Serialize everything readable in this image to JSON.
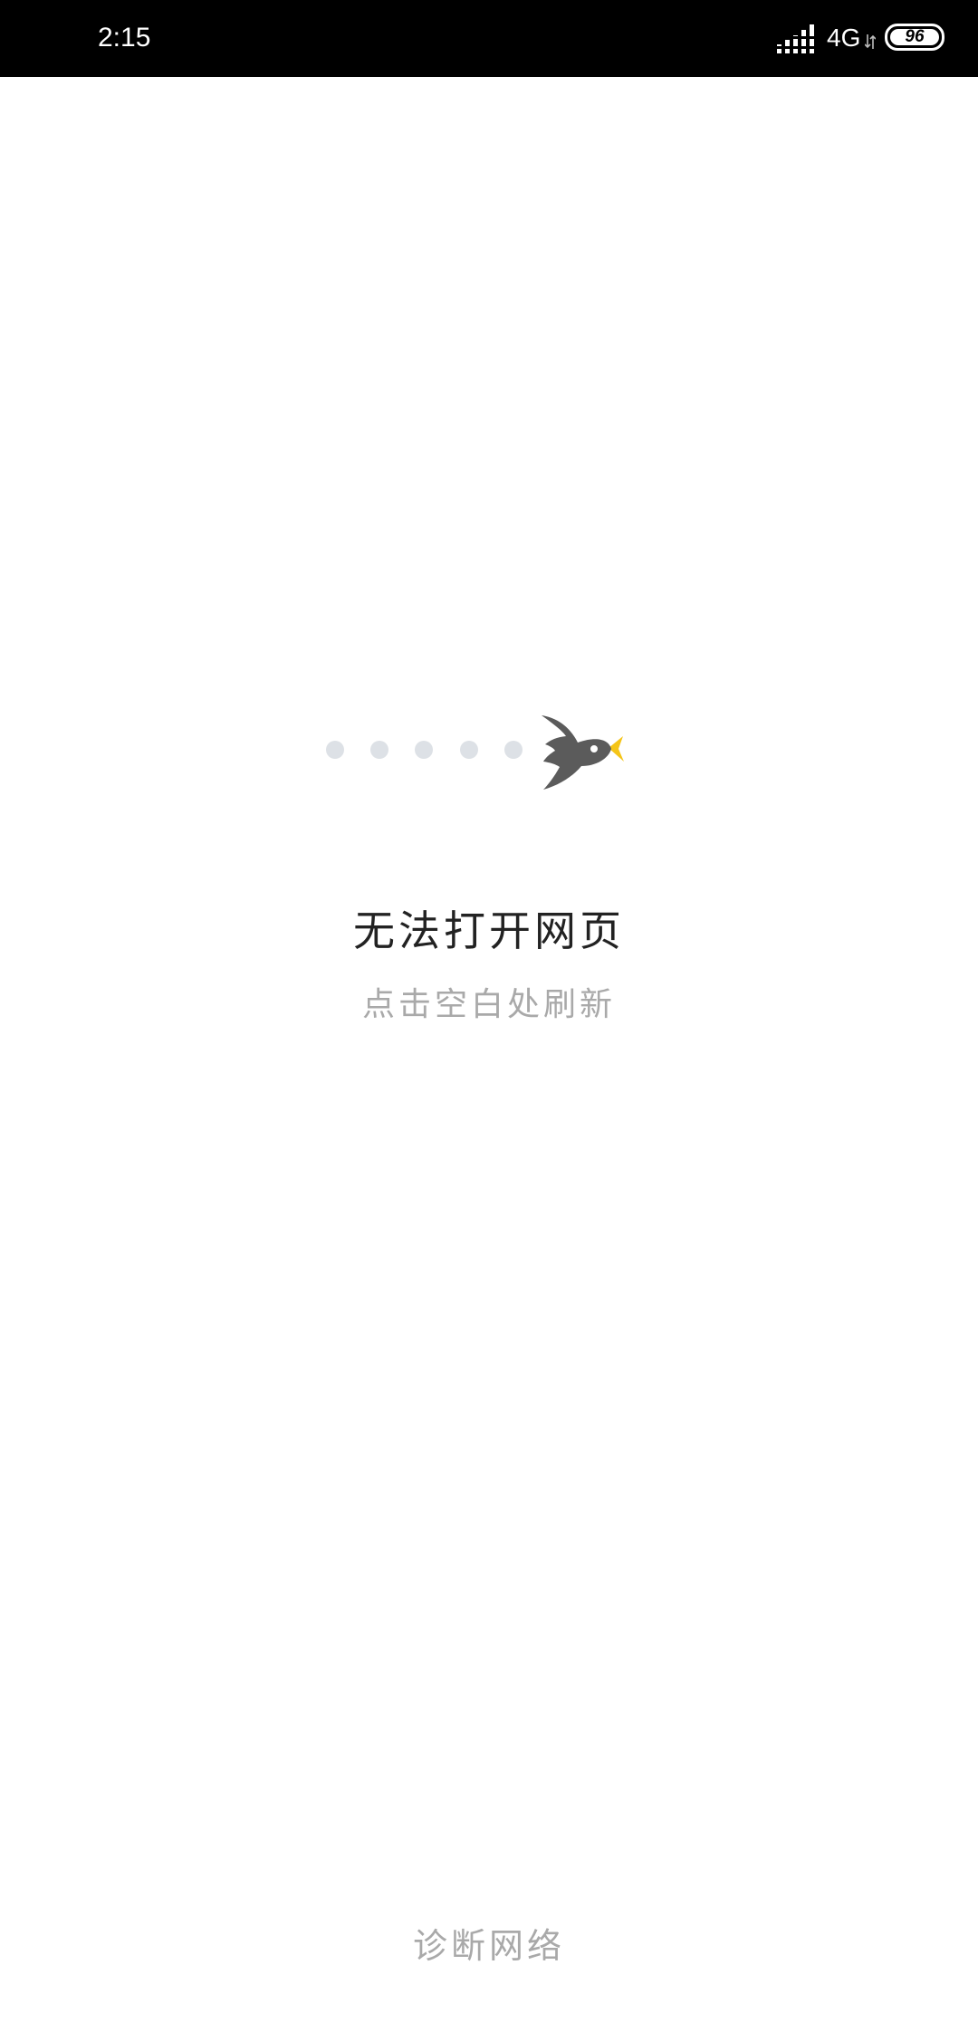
{
  "status_bar": {
    "time": "2:15",
    "network": "4G",
    "battery": "96",
    "icons": [
      "signal-icon",
      "network-activity-icon",
      "battery-icon"
    ]
  },
  "error_page": {
    "title": "无法打开网页",
    "hint": "点击空白处刷新",
    "diagnose_label": "诊断网络",
    "illustration": "bird-icon",
    "colors": {
      "bird": "#5b5b5b",
      "beak": "#f5c518",
      "dots": "#dde1e6",
      "title": "#222222",
      "hint": "#a9a9a9"
    }
  }
}
